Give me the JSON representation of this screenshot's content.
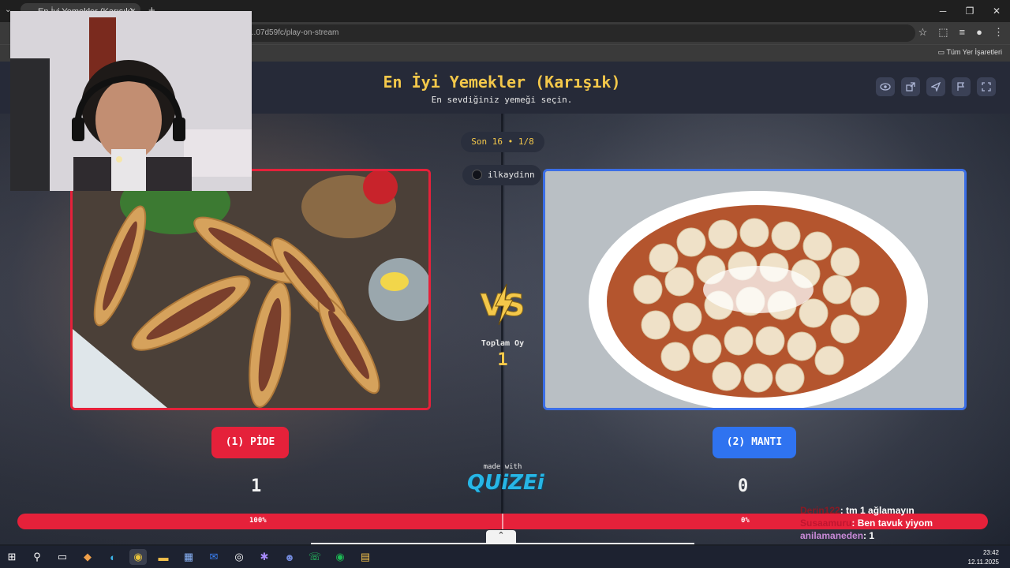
{
  "browser": {
    "tab_title": "En İyi Yemekler (Karışık) - Tierj...",
    "tab_close": "×",
    "new_tab": "+",
    "url": "...07d59fc/play-on-stream",
    "bookmarks_label": "Tüm Yer İşaretleri",
    "window_minimize": "─",
    "window_restore": "❐",
    "window_close": "✕"
  },
  "header": {
    "title": "En İyi Yemekler (Karışık)",
    "subtitle": "En sevdiğiniz yemeği seçin.",
    "buttons": [
      "eye-icon",
      "share-icon",
      "send-icon",
      "flag-icon",
      "fullscreen-icon"
    ]
  },
  "round": {
    "label": "Son 16 • 1/8"
  },
  "player": {
    "username": "ilkaydinn"
  },
  "versus": {
    "total_votes_label": "Toplam Oy",
    "total_votes": "1"
  },
  "left_option": {
    "label": "(1) PİDE",
    "votes": "1",
    "percent": "100%",
    "share": 1.0,
    "border_color": "#e5213a"
  },
  "right_option": {
    "label": "(2) MANTI",
    "votes": "0",
    "percent": "0%",
    "share": 0.0,
    "border_color": "#3b6ee6"
  },
  "branding": {
    "made_with": "made with",
    "logo": "QUiZEi"
  },
  "chat": [
    {
      "user": "Derin122",
      "message": ": tm 1 ağlamayın",
      "color": "#8a1a24"
    },
    {
      "user": "Susaamuru",
      "message": ": Ben tavuk yiyom",
      "color": "#c01630"
    },
    {
      "user": "anilamaneden",
      "message": ": 1",
      "color": "#c98ad8"
    }
  ],
  "taskbar": {
    "time": "23:42",
    "date": "12.11.2025"
  },
  "colors": {
    "accent_yellow": "#f4c84a",
    "red": "#e5213a",
    "blue": "#2f73f0"
  }
}
